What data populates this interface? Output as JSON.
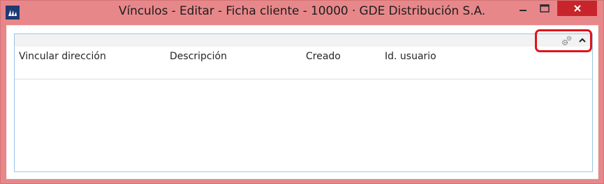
{
  "window": {
    "title": "Vínculos - Editar - Ficha cliente - 10000 · GDE Distribución S.A.",
    "app_icon": "dynamics-nav-icon",
    "controls": [
      "minimize-icon",
      "maximize-icon",
      "close-icon"
    ],
    "close_button_color": "#c7252b",
    "frame_color": "#e8878a"
  },
  "grid": {
    "toolbar_icons": [
      "gear-icon",
      "collapse-icon"
    ],
    "highlight_color": "#e0131a",
    "columns": [
      {
        "label": "Vincular dirección"
      },
      {
        "label": "Descripción"
      },
      {
        "label": "Creado"
      },
      {
        "label": "Id. usuario"
      }
    ],
    "rows": []
  }
}
